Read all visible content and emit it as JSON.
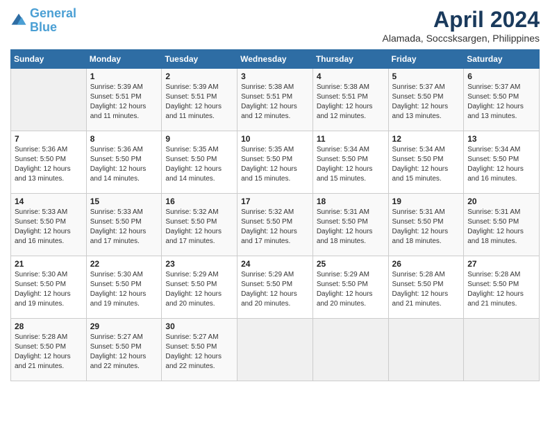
{
  "header": {
    "logo_line1": "General",
    "logo_line2": "Blue",
    "month": "April 2024",
    "location": "Alamada, Soccsksargen, Philippines"
  },
  "weekdays": [
    "Sunday",
    "Monday",
    "Tuesday",
    "Wednesday",
    "Thursday",
    "Friday",
    "Saturday"
  ],
  "weeks": [
    [
      {
        "day": "",
        "empty": true
      },
      {
        "day": "1",
        "sunrise": "5:39 AM",
        "sunset": "5:51 PM",
        "daylight": "12 hours and 11 minutes."
      },
      {
        "day": "2",
        "sunrise": "5:39 AM",
        "sunset": "5:51 PM",
        "daylight": "12 hours and 11 minutes."
      },
      {
        "day": "3",
        "sunrise": "5:38 AM",
        "sunset": "5:51 PM",
        "daylight": "12 hours and 12 minutes."
      },
      {
        "day": "4",
        "sunrise": "5:38 AM",
        "sunset": "5:51 PM",
        "daylight": "12 hours and 12 minutes."
      },
      {
        "day": "5",
        "sunrise": "5:37 AM",
        "sunset": "5:50 PM",
        "daylight": "12 hours and 13 minutes."
      },
      {
        "day": "6",
        "sunrise": "5:37 AM",
        "sunset": "5:50 PM",
        "daylight": "12 hours and 13 minutes."
      }
    ],
    [
      {
        "day": "7",
        "sunrise": "5:36 AM",
        "sunset": "5:50 PM",
        "daylight": "12 hours and 13 minutes."
      },
      {
        "day": "8",
        "sunrise": "5:36 AM",
        "sunset": "5:50 PM",
        "daylight": "12 hours and 14 minutes."
      },
      {
        "day": "9",
        "sunrise": "5:35 AM",
        "sunset": "5:50 PM",
        "daylight": "12 hours and 14 minutes."
      },
      {
        "day": "10",
        "sunrise": "5:35 AM",
        "sunset": "5:50 PM",
        "daylight": "12 hours and 15 minutes."
      },
      {
        "day": "11",
        "sunrise": "5:34 AM",
        "sunset": "5:50 PM",
        "daylight": "12 hours and 15 minutes."
      },
      {
        "day": "12",
        "sunrise": "5:34 AM",
        "sunset": "5:50 PM",
        "daylight": "12 hours and 15 minutes."
      },
      {
        "day": "13",
        "sunrise": "5:34 AM",
        "sunset": "5:50 PM",
        "daylight": "12 hours and 16 minutes."
      }
    ],
    [
      {
        "day": "14",
        "sunrise": "5:33 AM",
        "sunset": "5:50 PM",
        "daylight": "12 hours and 16 minutes."
      },
      {
        "day": "15",
        "sunrise": "5:33 AM",
        "sunset": "5:50 PM",
        "daylight": "12 hours and 17 minutes."
      },
      {
        "day": "16",
        "sunrise": "5:32 AM",
        "sunset": "5:50 PM",
        "daylight": "12 hours and 17 minutes."
      },
      {
        "day": "17",
        "sunrise": "5:32 AM",
        "sunset": "5:50 PM",
        "daylight": "12 hours and 17 minutes."
      },
      {
        "day": "18",
        "sunrise": "5:31 AM",
        "sunset": "5:50 PM",
        "daylight": "12 hours and 18 minutes."
      },
      {
        "day": "19",
        "sunrise": "5:31 AM",
        "sunset": "5:50 PM",
        "daylight": "12 hours and 18 minutes."
      },
      {
        "day": "20",
        "sunrise": "5:31 AM",
        "sunset": "5:50 PM",
        "daylight": "12 hours and 18 minutes."
      }
    ],
    [
      {
        "day": "21",
        "sunrise": "5:30 AM",
        "sunset": "5:50 PM",
        "daylight": "12 hours and 19 minutes."
      },
      {
        "day": "22",
        "sunrise": "5:30 AM",
        "sunset": "5:50 PM",
        "daylight": "12 hours and 19 minutes."
      },
      {
        "day": "23",
        "sunrise": "5:29 AM",
        "sunset": "5:50 PM",
        "daylight": "12 hours and 20 minutes."
      },
      {
        "day": "24",
        "sunrise": "5:29 AM",
        "sunset": "5:50 PM",
        "daylight": "12 hours and 20 minutes."
      },
      {
        "day": "25",
        "sunrise": "5:29 AM",
        "sunset": "5:50 PM",
        "daylight": "12 hours and 20 minutes."
      },
      {
        "day": "26",
        "sunrise": "5:28 AM",
        "sunset": "5:50 PM",
        "daylight": "12 hours and 21 minutes."
      },
      {
        "day": "27",
        "sunrise": "5:28 AM",
        "sunset": "5:50 PM",
        "daylight": "12 hours and 21 minutes."
      }
    ],
    [
      {
        "day": "28",
        "sunrise": "5:28 AM",
        "sunset": "5:50 PM",
        "daylight": "12 hours and 21 minutes."
      },
      {
        "day": "29",
        "sunrise": "5:27 AM",
        "sunset": "5:50 PM",
        "daylight": "12 hours and 22 minutes."
      },
      {
        "day": "30",
        "sunrise": "5:27 AM",
        "sunset": "5:50 PM",
        "daylight": "12 hours and 22 minutes."
      },
      {
        "day": "",
        "empty": true
      },
      {
        "day": "",
        "empty": true
      },
      {
        "day": "",
        "empty": true
      },
      {
        "day": "",
        "empty": true
      }
    ]
  ],
  "labels": {
    "sunrise": "Sunrise:",
    "sunset": "Sunset:",
    "daylight": "Daylight:"
  }
}
